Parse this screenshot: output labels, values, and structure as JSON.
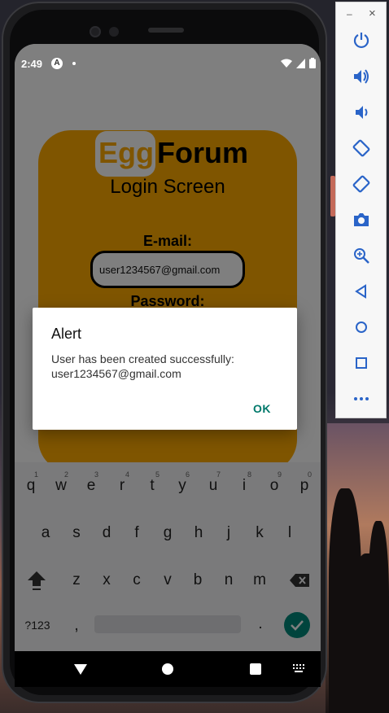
{
  "status_bar": {
    "time": "2:49",
    "notification_badge": "A"
  },
  "app": {
    "logo": {
      "part1": "Egg",
      "part2": "Forum"
    },
    "subtitle": "Login Screen",
    "email_label": "E-mail:",
    "email_value": "user1234567@gmail.com",
    "password_label": "Password:"
  },
  "alert": {
    "title": "Alert",
    "message": "User has been created successfully: user1234567@gmail.com",
    "ok_label": "OK"
  },
  "keyboard": {
    "row1": [
      "q",
      "w",
      "e",
      "r",
      "t",
      "y",
      "u",
      "i",
      "o",
      "p"
    ],
    "row1_numbers": [
      "1",
      "2",
      "3",
      "4",
      "5",
      "6",
      "7",
      "8",
      "9",
      "0"
    ],
    "row2": [
      "a",
      "s",
      "d",
      "f",
      "g",
      "h",
      "j",
      "k",
      "l"
    ],
    "row3": [
      "z",
      "x",
      "c",
      "v",
      "b",
      "n",
      "m"
    ],
    "symbols_key": "?123",
    "comma": ",",
    "period": "."
  },
  "emulator_toolbar": {
    "minimize": "–",
    "close": "×",
    "tools": [
      "power-icon",
      "volume-up-icon",
      "volume-down-icon",
      "rotate-left-icon",
      "rotate-right-icon",
      "camera-icon",
      "zoom-icon",
      "back-icon",
      "home-icon",
      "overview-icon",
      "more-icon"
    ]
  },
  "colors": {
    "accent": "#ffaa00",
    "dialog_button": "#00796b",
    "enter_key": "#00897b"
  }
}
